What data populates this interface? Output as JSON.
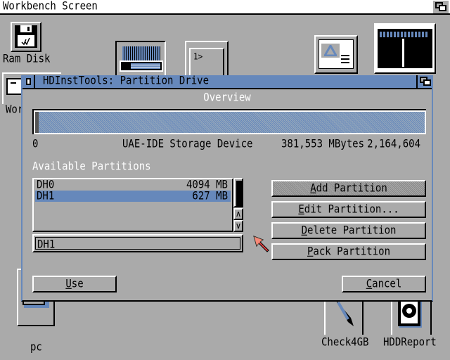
{
  "screen": {
    "title": "Workbench Screen"
  },
  "desktop_icons": [
    {
      "name": "ram-disk",
      "label": "Ram Disk",
      "icon": "floppy-disk-icon"
    },
    {
      "name": "workbench",
      "label": "Wor",
      "icon": "drawer-icon"
    },
    {
      "name": "prefs-tool",
      "label": "",
      "icon": "tool-icon"
    },
    {
      "name": "shell",
      "label": "",
      "icon": "shell-icon"
    },
    {
      "name": "document",
      "label": "",
      "icon": "document-icon"
    },
    {
      "name": "screen-preview",
      "label": "",
      "icon": "screen-icon"
    },
    {
      "name": "pc",
      "label": "pc",
      "icon": "drawer-icon"
    },
    {
      "name": "check4gb",
      "label": "Check4GB",
      "icon": "tool-icon"
    },
    {
      "name": "hddreport",
      "label": "HDDReport",
      "icon": "report-icon"
    }
  ],
  "window": {
    "title": "HDInstTools: Partition Drive",
    "overview": {
      "heading": "Overview",
      "start": "0",
      "device": "UAE-IDE Storage Device",
      "capacity": "381,553 MBytes",
      "end": "2,164,604"
    },
    "partitions": {
      "heading": "Available Partitions",
      "items": [
        {
          "name": "DH0",
          "size": "4094 MB",
          "selected": false
        },
        {
          "name": "DH1",
          "size": "627 MB",
          "selected": true
        }
      ],
      "selected_name": "DH1"
    },
    "buttons": {
      "add": {
        "key": "A",
        "rest": "dd Partition",
        "disabled": true
      },
      "edit": {
        "key": "E",
        "rest": "dit Partition..."
      },
      "delete": {
        "key": "D",
        "rest": "elete Partition"
      },
      "pack": {
        "key": "P",
        "rest": "ack Partition"
      },
      "use": {
        "key": "U",
        "rest": "se"
      },
      "cancel": {
        "key": "C",
        "rest": "ancel"
      }
    },
    "scroll": {
      "up": "∧",
      "down": "∨"
    }
  },
  "colors": {
    "background": "#aaaaaa",
    "accent": "#6688bb",
    "pointer": "#ee4444"
  }
}
